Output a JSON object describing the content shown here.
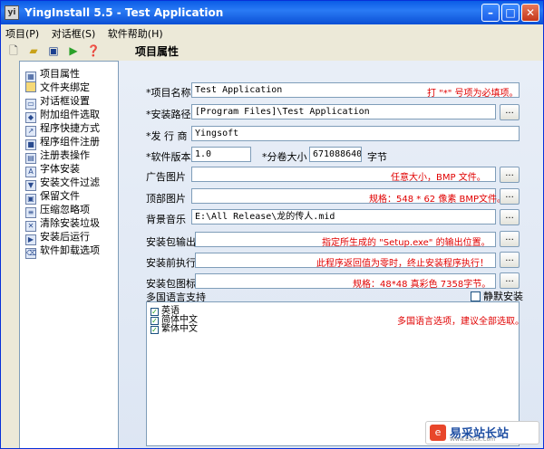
{
  "window": {
    "title": "YingInstall 5.5 - Test Application",
    "app_icon": "yi"
  },
  "menu": [
    "项目(P)",
    "对话框(S)",
    "软件帮助(H)"
  ],
  "toolbar": {
    "icons": [
      "new-icon",
      "open-icon",
      "save-icon",
      "run-icon",
      "help-icon"
    ]
  },
  "panel_title": "项目属性",
  "sidebar": {
    "items": [
      {
        "label": "项目属性",
        "icon": "grid"
      },
      {
        "label": "文件夹绑定",
        "icon": "folder"
      },
      {
        "label": "对话框设置",
        "icon": "dialog"
      },
      {
        "label": "附加组件选取",
        "icon": "component"
      },
      {
        "label": "程序快捷方式",
        "icon": "shortcut"
      },
      {
        "label": "程序组件注册",
        "icon": "register"
      },
      {
        "label": "注册表操作",
        "icon": "registry"
      },
      {
        "label": "字体安装",
        "icon": "font"
      },
      {
        "label": "安装文件过滤",
        "icon": "filter"
      },
      {
        "label": "保留文件",
        "icon": "keep"
      },
      {
        "label": "压缩忽略项",
        "icon": "compress"
      },
      {
        "label": "清除安装垃圾",
        "icon": "clean"
      },
      {
        "label": "安装后运行",
        "icon": "run"
      },
      {
        "label": "软件卸载选项",
        "icon": "uninstall"
      }
    ]
  },
  "form": {
    "project_name": {
      "label": "*项目名称",
      "value": "Test Application",
      "hint": "打 \"*\" 号项为必填项。"
    },
    "install_path": {
      "label": "*安装路径",
      "value": "[Program Files]\\Test Application"
    },
    "publisher": {
      "label": "*发 行 商",
      "value": "Yingsoft"
    },
    "version": {
      "label": "*软件版本",
      "value": "1.0"
    },
    "volume_size": {
      "label": "*分卷大小",
      "value": "671088640",
      "unit": "字节"
    },
    "ad_image": {
      "label": "广告图片",
      "value": "",
      "hint": "任意大小，BMP 文件。"
    },
    "top_image": {
      "label": "顶部图片",
      "value": "",
      "hint": "规格：548 * 62 像素 BMP文件。"
    },
    "bg_music": {
      "label": "背景音乐",
      "value": "E:\\All Release\\龙的传人.mid"
    },
    "output": {
      "label": "安装包输出",
      "value": "",
      "hint": "指定所生成的 \"Setup.exe\" 的输出位置。"
    },
    "pre_run": {
      "label": "安装前执行",
      "value": "",
      "hint": "此程序返回值为零时，终止安装程序执行！"
    },
    "pkg_icon": {
      "label": "安装包图标",
      "value": "",
      "hint": "规格：48*48 真彩色 7358字节。"
    },
    "multilang": {
      "label": "多国语言支持",
      "hint": "多国语言选项，建议全部选取。"
    },
    "silent": {
      "label": "静默安装",
      "checked": false
    },
    "languages": [
      {
        "label": "英语",
        "checked": true
      },
      {
        "label": "简体中文",
        "checked": true
      },
      {
        "label": "繁体中文",
        "checked": true
      }
    ]
  },
  "browse_label": "...",
  "watermark": {
    "text": "易采站长站",
    "sub": "Www.Easck.Com"
  },
  "colors": {
    "hint": "#e00000",
    "titlebar": "#0a5ce6"
  }
}
